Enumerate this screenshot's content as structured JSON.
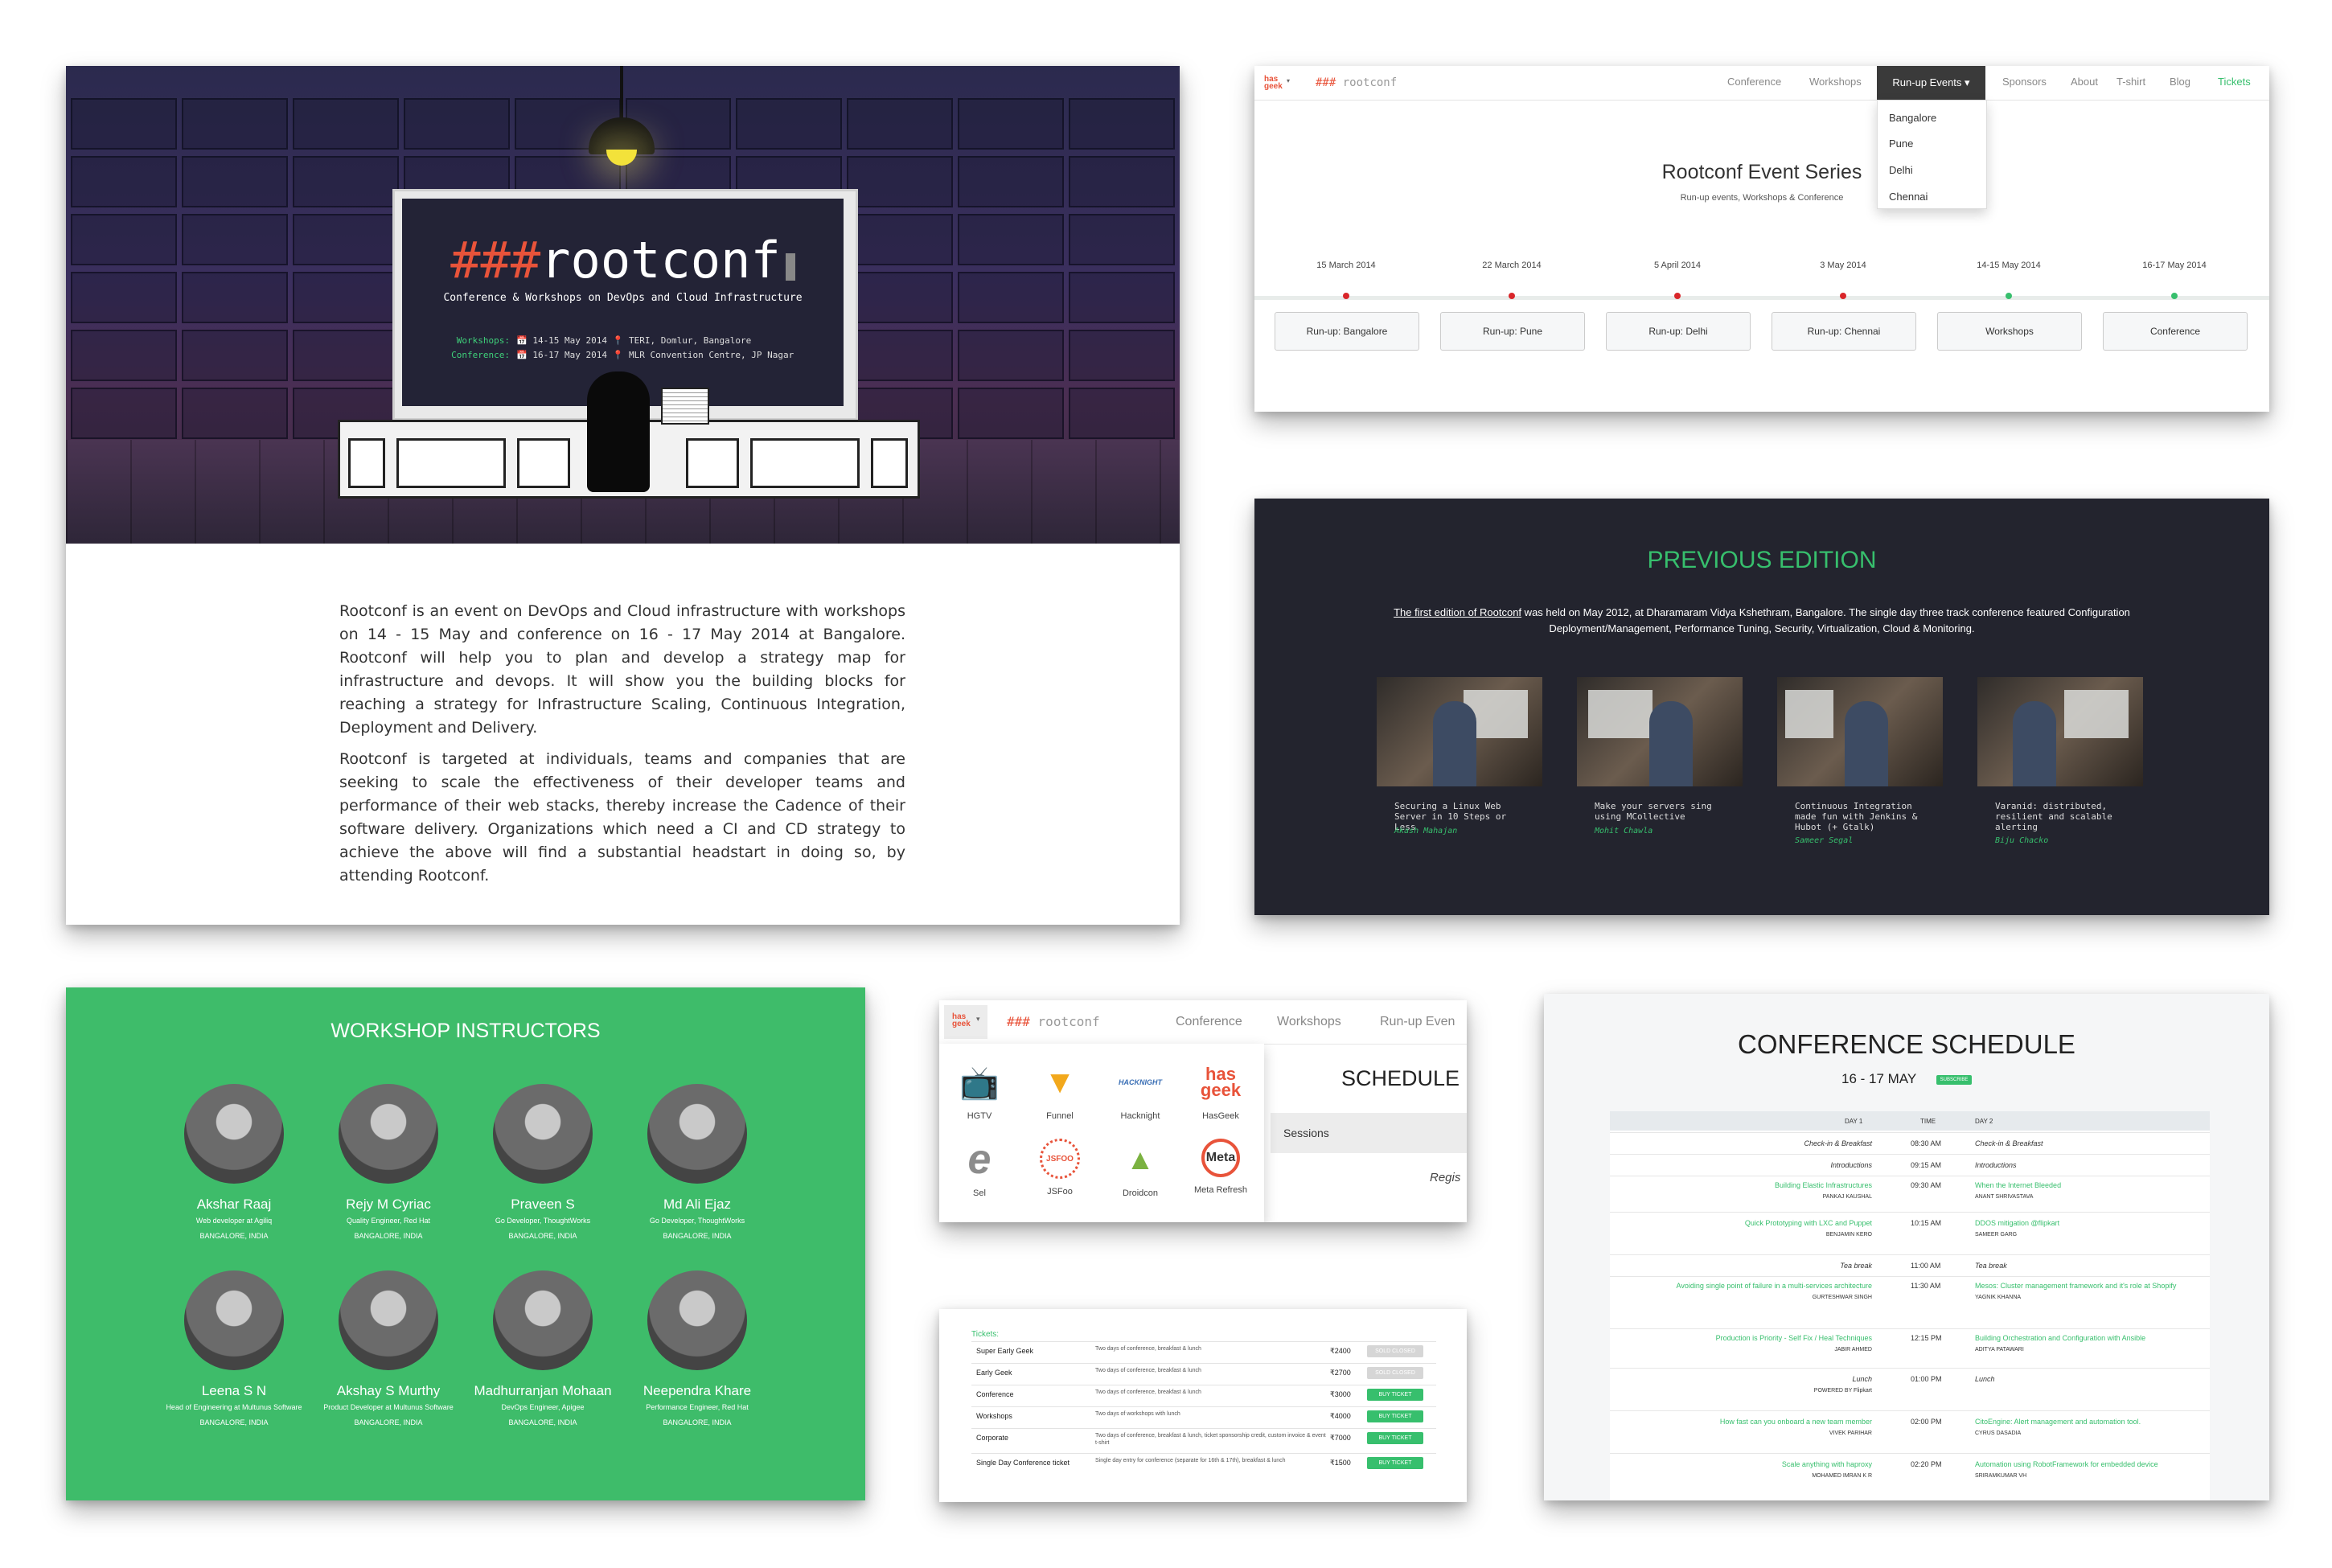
{
  "hero": {
    "logo_hash": "###",
    "logo_text": "rootconf",
    "tagline": "Conference & Workshops on DevOps and Cloud Infrastructure",
    "workshops_label": "Workshops:",
    "workshops_value": "📅 14-15 May 2014  📍 TERI, Domlur, Bangalore",
    "conference_label": "Conference:",
    "conference_value": "📅 16-17 May 2014  📍 MLR Convention Centre, JP Nagar"
  },
  "about": {
    "p1": "Rootconf is an event on DevOps and Cloud infrastructure with workshops on 14 - 15 May and conference on 16 - 17 May 2014 at Bangalore. Rootconf will help you to plan and develop a strategy map for infrastructure and devops. It will show you the building blocks for reaching a strategy for Infrastructure Scaling, Continuous Integration, Deployment and Delivery.",
    "p2": "Rootconf is targeted at individuals, teams and companies that are seeking to scale the effectiveness of their developer teams and performance of their web stacks, thereby increase the Cadence of their software delivery. Organizations which need a CI and CD strategy to achieve the above will find a substantial headstart in doing so, by attending Rootconf."
  },
  "nav": {
    "hasgeek_top": "has",
    "hasgeek_bottom": "geek",
    "logo_hash": "###",
    "logo_text": "rootconf",
    "items": [
      "Conference",
      "Workshops",
      "Run-up Events ▾",
      "Sponsors",
      "About",
      "T-shirt",
      "Blog",
      "Tickets"
    ],
    "dropdown": [
      "Bangalore",
      "Pune",
      "Delhi",
      "Chennai"
    ]
  },
  "series": {
    "title": "Rootconf Event Series",
    "subtitle": "Run-up events, Workshops & Conference",
    "events": [
      {
        "date": "15 March 2014",
        "label": "Run-up: Bangalore"
      },
      {
        "date": "22 March 2014",
        "label": "Run-up: Pune"
      },
      {
        "date": "5 April 2014",
        "label": "Run-up: Delhi"
      },
      {
        "date": "3 May 2014",
        "label": "Run-up: Chennai"
      },
      {
        "date": "14-15 May 2014",
        "label": "Workshops"
      },
      {
        "date": "16-17 May 2014",
        "label": "Conference"
      }
    ]
  },
  "previous": {
    "title": "PREVIOUS EDITION",
    "link_text": "The first edition of Rootconf",
    "text": " was held on May 2012, at Dharamaram Vidya Kshethram, Bangalore. The single day three track conference featured Configuration Deployment/Management, Performance Tuning, Security, Virtualization, Cloud & Monitoring.",
    "videos": [
      {
        "caption": "Securing a Linux Web Server in 10 Steps or Less",
        "author": "Akash Mahajan"
      },
      {
        "caption": "Make your servers sing using MCollective",
        "author": "Mohit Chawla"
      },
      {
        "caption": "Continuous Integration made fun with Jenkins & Hubot (+ Gtalk)",
        "author": "Sameer Segal"
      },
      {
        "caption": "Varanid: distributed, resilient and scalable alerting",
        "author": "Biju Chacko"
      }
    ]
  },
  "instructors": {
    "title": "WORKSHOP INSTRUCTORS",
    "people": [
      {
        "name": "Akshar Raaj",
        "role": "Web developer at Agiliq",
        "loc": "BANGALORE, INDIA"
      },
      {
        "name": "Rejy M Cyriac",
        "role": "Quality Engineer, Red Hat",
        "loc": "BANGALORE, INDIA"
      },
      {
        "name": "Praveen S",
        "role": "Go Developer, ThoughtWorks",
        "loc": "BANGALORE, INDIA"
      },
      {
        "name": "Md Ali Ejaz",
        "role": "Go Developer, ThoughtWorks",
        "loc": "BANGALORE, INDIA"
      },
      {
        "name": "Leena S N",
        "role": "Head of Engineering at Multunus Software",
        "loc": "BANGALORE, INDIA"
      },
      {
        "name": "Akshay S Murthy",
        "role": "Product Developer at Multunus Software",
        "loc": "BANGALORE, INDIA"
      },
      {
        "name": "Madhurranjan Mohaan",
        "role": "DevOps Engineer, Apigee",
        "loc": "BANGALORE, INDIA"
      },
      {
        "name": "Neependra Khare",
        "role": "Performance Engineer, Red Hat",
        "loc": "BANGALORE, INDIA"
      }
    ]
  },
  "apps_menu": {
    "nav_items": [
      "Conference",
      "Workshops",
      "Run-up Even"
    ],
    "apps": [
      {
        "label": "HGTV",
        "icon": "tv-icon",
        "glyph": "📺",
        "color": "#f29c38"
      },
      {
        "label": "Funnel",
        "icon": "funnel-icon",
        "glyph": "▼",
        "color": "#f2a81c"
      },
      {
        "label": "Hacknight",
        "icon": "hacknight-icon",
        "glyph": "HACKNIGHT",
        "color": "#3a6fb5"
      },
      {
        "label": "HasGeek",
        "icon": "hasgeek-icon",
        "glyph": "has geek",
        "color": "#e8533a"
      },
      {
        "label": "Sel",
        "icon": "sel-icon",
        "glyph": "e",
        "color": "#8c8c8c"
      },
      {
        "label": "JSFoo",
        "icon": "jsfoo-icon",
        "glyph": "JSFOO",
        "color": "#e8533a"
      },
      {
        "label": "Droidcon",
        "icon": "droidcon-icon",
        "glyph": "▲",
        "color": "#7bb241"
      },
      {
        "label": "Meta Refresh",
        "icon": "metarefresh-icon",
        "glyph": "Meta",
        "color": "#e8533a"
      }
    ],
    "schedule_heading": "SCHEDULE",
    "sessions_label": "Sessions",
    "register_label": "Regis"
  },
  "tickets": {
    "heading": "Tickets:",
    "rows": [
      {
        "name": "Super Early Geek",
        "desc": "Two days of conference, breakfast & lunch",
        "price": "₹2400",
        "btn": "SOLD CLOSED",
        "active": false
      },
      {
        "name": "Early Geek",
        "desc": "Two days of conference, breakfast & lunch",
        "price": "₹2700",
        "btn": "SOLD CLOSED",
        "active": false
      },
      {
        "name": "Conference",
        "desc": "Two days of conference, breakfast & lunch",
        "price": "₹3000",
        "btn": "BUY TICKET",
        "active": true
      },
      {
        "name": "Workshops",
        "desc": "Two days of workshops with lunch",
        "price": "₹4000",
        "btn": "BUY TICKET",
        "active": true
      },
      {
        "name": "Corporate",
        "desc": "Two days of conference, breakfast & lunch, ticket sponsorship credit, custom invoice & event t-shirt",
        "price": "₹7000",
        "btn": "BUY TICKET",
        "active": true
      },
      {
        "name": "Single Day Conference ticket",
        "desc": "Single day entry for conference (separate for 16th & 17th), breakfast & lunch",
        "price": "₹1500",
        "btn": "BUY TICKET",
        "active": true
      }
    ]
  },
  "schedule": {
    "title": "CONFERENCE SCHEDULE",
    "date": "16 - 17 MAY",
    "badge": "SUBSCRIBE",
    "head": {
      "day1": "DAY 1",
      "time": "TIME",
      "day2": "DAY 2"
    },
    "rows": [
      {
        "left": "Check-in & Breakfast",
        "left_speaker": "",
        "time": "08:30 AM",
        "right": "Check-in & Breakfast",
        "right_speaker": "",
        "kind": "break"
      },
      {
        "left": "Introductions",
        "left_speaker": "",
        "time": "09:15 AM",
        "right": "Introductions",
        "right_speaker": "",
        "kind": "break"
      },
      {
        "left": "Building Elastic Infrastructures",
        "left_speaker": "PANKAJ KAUSHAL",
        "time": "09:30 AM",
        "right": "When the Internet Bleeded",
        "right_speaker": "ANANT SHRIVASTAVA",
        "kind": "talk"
      },
      {
        "left": "Quick Prototyping with LXC and Puppet",
        "left_speaker": "BENJAMIN KERO",
        "time": "10:15 AM",
        "right": "DDOS mitigation @flipkart",
        "right_speaker": "SAMEER GARG",
        "kind": "talk"
      },
      {
        "left": "Tea break",
        "left_speaker": "",
        "time": "11:00 AM",
        "right": "Tea break",
        "right_speaker": "",
        "kind": "break"
      },
      {
        "left": "Avoiding single point of failure in a multi-services architecture",
        "left_speaker": "GURTESHWAR SINGH",
        "time": "11:30 AM",
        "right": "Mesos: Cluster management framework and it's role at Shopify",
        "right_speaker": "YAGNIK KHANNA",
        "kind": "talk"
      },
      {
        "left": "Production is Priority - Self Fix / Heal Techniques",
        "left_speaker": "JABIR AHMED",
        "time": "12:15 PM",
        "right": "Building Orchestration and Configuration with Ansible",
        "right_speaker": "ADITYA PATAWARI",
        "kind": "talk"
      },
      {
        "left": "Lunch",
        "left_speaker": "POWERED BY Flipkart",
        "time": "01:00 PM",
        "right": "Lunch",
        "right_speaker": "",
        "kind": "break"
      },
      {
        "left": "How fast can you onboard a new team member",
        "left_speaker": "VIVEK PARIHAR",
        "time": "02:00 PM",
        "right": "CitoEngine: Alert management and automation tool.",
        "right_speaker": "CYRUS DASADIA",
        "kind": "talk"
      },
      {
        "left": "Scale anything with haproxy",
        "left_speaker": "MOHAMED IMRAN K R",
        "time": "02:20 PM",
        "right": "Automation using RobotFramework for embedded device",
        "right_speaker": "SRIRAMKUMAR VH",
        "kind": "talk"
      }
    ]
  }
}
